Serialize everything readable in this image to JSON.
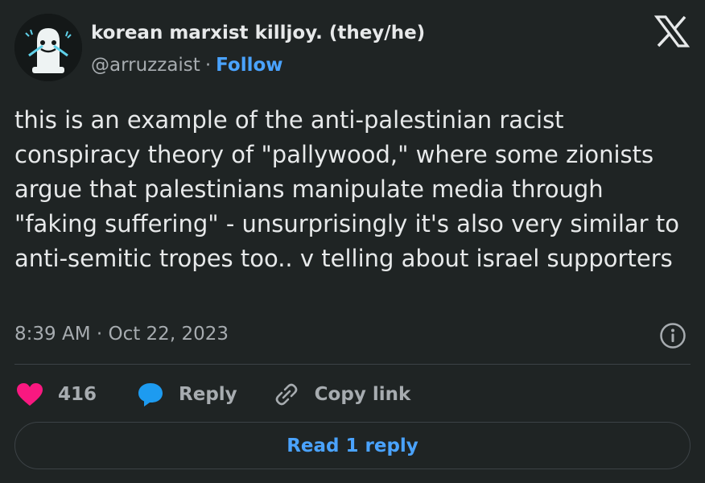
{
  "author": {
    "display_name": "korean marxist killjoy. (they/he)",
    "handle": "@arruzzaist",
    "separator": "·",
    "follow_label": "Follow"
  },
  "tweet": {
    "text": "this is an example of the anti-palestinian racist conspiracy theory of \"pallywood,\" where some zionists argue that palestinians manipulate media through \"faking suffering\" - unsurprisingly it's also very similar to anti-semitic tropes too.. v telling about israel supporters",
    "timestamp": "8:39 AM · Oct 22, 2023"
  },
  "actions": {
    "like_count": "416",
    "reply_label": "Reply",
    "copy_link_label": "Copy link"
  },
  "read_replies_label": "Read 1 reply",
  "colors": {
    "background": "#1f2424",
    "accent": "#4aa3ff",
    "like": "#f91880",
    "reply_icon": "#1d9bf0",
    "muted": "#a7acb0"
  },
  "icons": {
    "logo": "x-logo-icon",
    "info": "info-icon",
    "like": "heart-icon",
    "reply": "speech-bubble-icon",
    "copy_link": "link-icon"
  }
}
